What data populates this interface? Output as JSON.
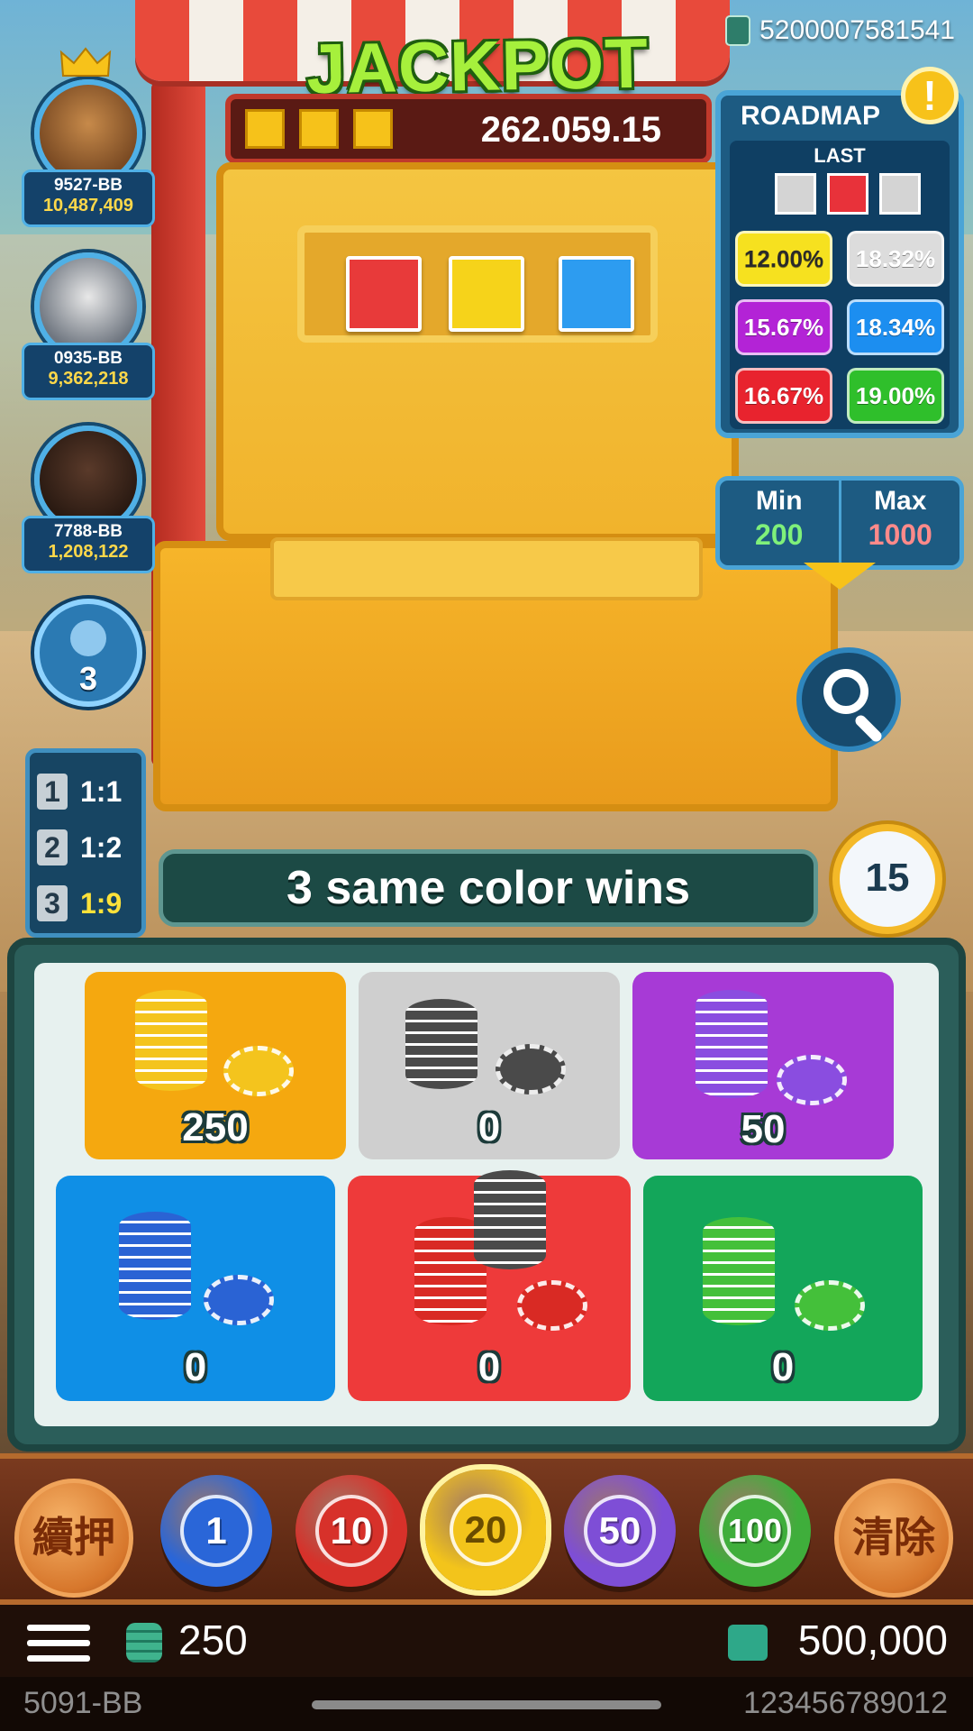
{
  "account_id": "5200007581541",
  "jackpot": {
    "title": "JACKPOT",
    "amount": "262.059.15"
  },
  "current_cards": [
    "#e83a3a",
    "#f6d31a",
    "#2d9cf0"
  ],
  "players": [
    {
      "name": "9527-BB",
      "balance": "10,487,409",
      "crown": true
    },
    {
      "name": "0935-BB",
      "balance": "9,362,218",
      "crown": false
    },
    {
      "name": "7788-BB",
      "balance": "1,208,122",
      "crown": false
    }
  ],
  "other_players_count": "3",
  "roadmap": {
    "title": "ROADMAP",
    "last_label": "LAST",
    "last_colors": [
      "#d4d4d4",
      "#e8323a",
      "#d4d4d4"
    ],
    "percentages": [
      {
        "label": "12.00%",
        "color": "#f6e11f",
        "text_color": "#2a2a2a"
      },
      {
        "label": "18.32%",
        "color": "#dcdcdc",
        "text_color": "#ffffff"
      },
      {
        "label": "15.67%",
        "color": "#b323d6",
        "text_color": "#ffffff"
      },
      {
        "label": "18.34%",
        "color": "#1c8ef0",
        "text_color": "#ffffff"
      },
      {
        "label": "16.67%",
        "color": "#e8232e",
        "text_color": "#ffffff"
      },
      {
        "label": "19.00%",
        "color": "#2fbf2b",
        "text_color": "#ffffff"
      }
    ]
  },
  "limits": {
    "min_label": "Min",
    "min_value": "200",
    "max_label": "Max",
    "max_value": "1000"
  },
  "odds": [
    {
      "count": "1",
      "ratio": "1:1",
      "highlight": false
    },
    {
      "count": "2",
      "ratio": "1:2",
      "highlight": false
    },
    {
      "count": "3",
      "ratio": "1:9",
      "highlight": true
    }
  ],
  "rule_text": "3 same color wins",
  "timer": "15",
  "bet_tiles": [
    {
      "color": "#f5a80f",
      "amount": "250",
      "chip": "#f4c41d"
    },
    {
      "color": "#cfcfcf",
      "amount": "0",
      "chip": "#4a4a4a"
    },
    {
      "color": "#a73ad6",
      "amount": "50",
      "chip": "#8a4de0"
    },
    {
      "color": "#0f8fe6",
      "amount": "0",
      "chip": "#2a63d4"
    },
    {
      "color": "#ee3a3a",
      "amount": "0",
      "chip": "#d92a24"
    },
    {
      "color": "#13a65a",
      "amount": "0",
      "chip": "#44c03a"
    }
  ],
  "chips": [
    {
      "label": "1",
      "color": "#2a66d8"
    },
    {
      "label": "10",
      "color": "#d7312a"
    },
    {
      "label": "20",
      "color": "#f3c41b"
    },
    {
      "label": "50",
      "color": "#7e4ed6"
    },
    {
      "label": "100",
      "color": "#3fae3b"
    }
  ],
  "rebet_label": "續押",
  "clear_label": "清除",
  "total_bet": "250",
  "wallet_balance": "500,000",
  "footer": {
    "player_id": "5091-BB",
    "round_id": "123456789012"
  }
}
